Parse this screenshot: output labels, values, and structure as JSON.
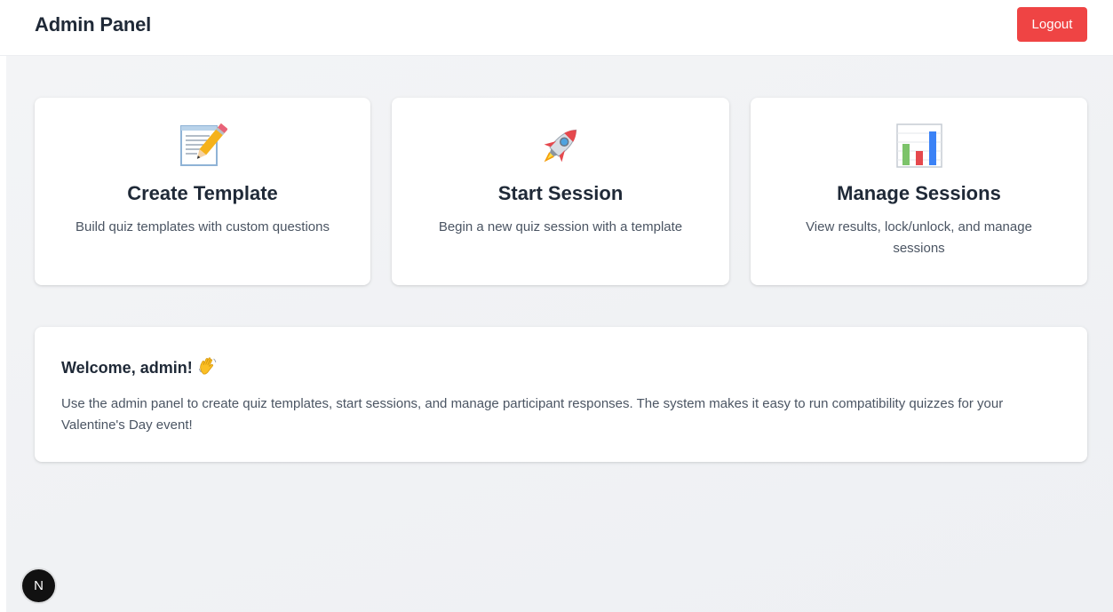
{
  "header": {
    "title": "Admin Panel",
    "logout_label": "Logout"
  },
  "cards": [
    {
      "icon": "memo-pencil-icon",
      "title": "Create Template",
      "description": "Build quiz templates with custom questions"
    },
    {
      "icon": "rocket-icon",
      "title": "Start Session",
      "description": "Begin a new quiz session with a template"
    },
    {
      "icon": "bar-chart-icon",
      "title": "Manage Sessions",
      "description": "View results, lock/unlock, and manage sessions"
    }
  ],
  "welcome": {
    "title": "Welcome, admin!",
    "icon": "waving-hand-icon",
    "text": "Use the admin panel to create quiz templates, start sessions, and manage participant responses. The system makes it easy to run compatibility quizzes for your Valentine's Day event!"
  },
  "dev_badge": {
    "label": "N"
  },
  "colors": {
    "accent_red": "#ef4444",
    "text_dark": "#1f2937",
    "text_muted": "#4b5563",
    "background": "#f3f4f6"
  }
}
